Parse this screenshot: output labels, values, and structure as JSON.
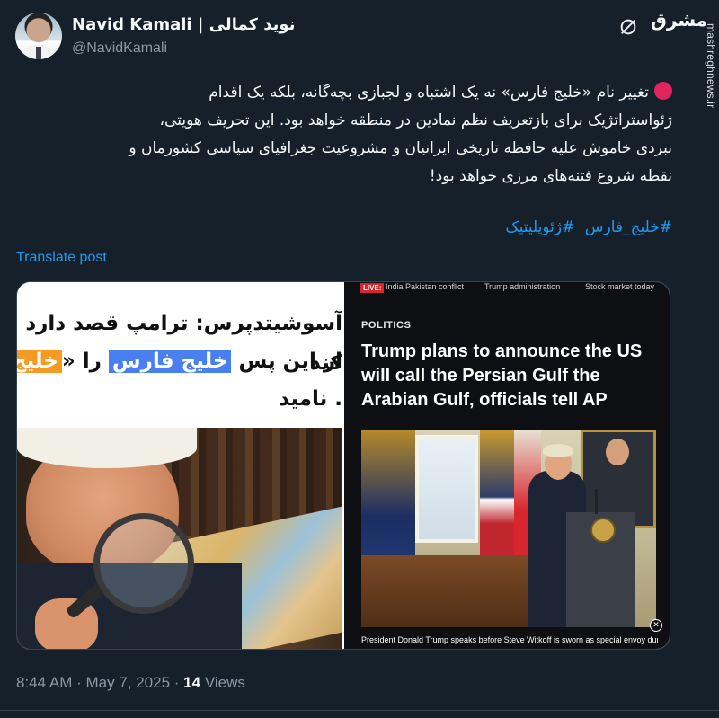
{
  "user": {
    "display_name": "Navid Kamali | نوید کمالی",
    "handle": "@NavidKamali"
  },
  "brand": {
    "logo_text": "مشرق",
    "watermark": "mashreghnews.ir"
  },
  "icons": {
    "grok": "grok-icon",
    "status": "red-circle-icon"
  },
  "tweet": {
    "line1": "تغییر نام «خلیج فارس» نه یک اشتباه و لجبازی بچه‌گانه، بلکه یک اقدام",
    "line2": "ژئواستراتژیک برای بازتعریف نظم نمادین در منطقه خواهد بود. این تحریف هویتی،",
    "line3": "نبردی خاموش علیه حافظه تاریخی ایرانیان و مشروعیت جغرافیای سیاسی کشورمان و",
    "line4": "نقطه شروع فتنه‌های مرزی خواهد بود!",
    "hashtags": [
      "#خلیج_فارس",
      "#ژئوپلیتیک"
    ],
    "translate_label": "Translate post"
  },
  "media_left": {
    "headline_line1": "آسوشیتدپرس: ترامپ قصد دارد اعلام کند",
    "headline_line2_pre": "از این پس",
    "headline_line2_blue": "خلیج فارس",
    "headline_line2_mid": "را «",
    "headline_line2_orange": "خلیج",
    "headline_line3": ". نامید"
  },
  "media_right": {
    "live_label": "LIVE:",
    "topics": [
      "India Pakistan conflict",
      "Trump administration",
      "Stock market today"
    ],
    "section": "POLITICS",
    "headline": "Trump plans to announce the US will call the Persian Gulf the Arabian Gulf, officials tell AP",
    "caption": "President Donald Trump speaks before Steve Witkoff is sworn as special envoy during",
    "close_symbol": "✕"
  },
  "meta": {
    "time": "8:44 AM",
    "separator": " · ",
    "date": "May 7, 2025",
    "views_count": "14",
    "views_label": "Views"
  },
  "colors": {
    "background": "#15202b",
    "link": "#1d9bf0",
    "muted": "#8b98a5",
    "status_red": "#e0245e"
  }
}
